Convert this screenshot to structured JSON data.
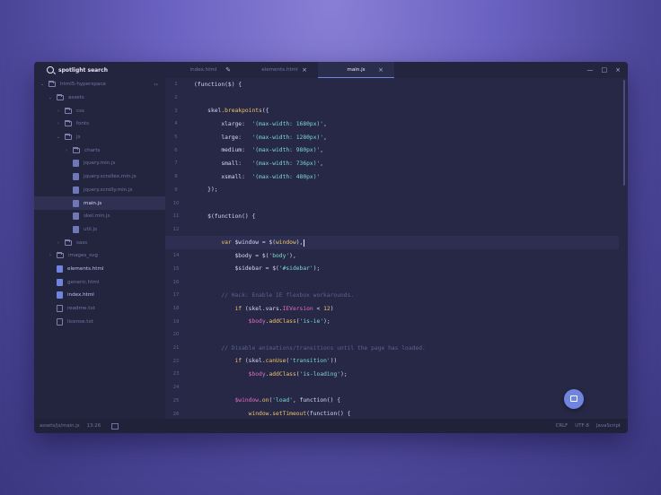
{
  "sidebar": {
    "search_label": "spotlight search",
    "tree": [
      {
        "label": "html5-hyperspace",
        "depth": 0,
        "kind": "folder",
        "chev": "⌄",
        "collapse": true
      },
      {
        "label": "assets",
        "depth": 1,
        "kind": "folder",
        "chev": "⌄"
      },
      {
        "label": "css",
        "depth": 2,
        "kind": "folder",
        "chev": "›"
      },
      {
        "label": "fonts",
        "depth": 2,
        "kind": "folder",
        "chev": "›"
      },
      {
        "label": "js",
        "depth": 2,
        "kind": "folder",
        "chev": "⌄"
      },
      {
        "label": "charts",
        "depth": 3,
        "kind": "folder",
        "chev": "›"
      },
      {
        "label": "jquery.min.js",
        "depth": 3,
        "kind": "js"
      },
      {
        "label": "jquery.scrollex.min.js",
        "depth": 3,
        "kind": "js"
      },
      {
        "label": "jquery.scrolly.min.js",
        "depth": 3,
        "kind": "js"
      },
      {
        "label": "main.js",
        "depth": 3,
        "kind": "js",
        "active": true
      },
      {
        "label": "skel.min.js",
        "depth": 3,
        "kind": "js"
      },
      {
        "label": "util.js",
        "depth": 3,
        "kind": "js"
      },
      {
        "label": "sass",
        "depth": 2,
        "kind": "folder",
        "chev": "›"
      },
      {
        "label": "images_svg",
        "depth": 1,
        "kind": "folder",
        "chev": "›"
      },
      {
        "label": "elements.html",
        "depth": 1,
        "kind": "html",
        "bright": true
      },
      {
        "label": "generic.html",
        "depth": 1,
        "kind": "html"
      },
      {
        "label": "index.html",
        "depth": 1,
        "kind": "html",
        "bright": true
      },
      {
        "label": "readme.txt",
        "depth": 1,
        "kind": "txt"
      },
      {
        "label": "license.txt",
        "depth": 1,
        "kind": "txt"
      }
    ],
    "collapse_label": "‹‹"
  },
  "tabs": [
    {
      "label": "index.html",
      "suffix": "✎",
      "active": false
    },
    {
      "label": "elements.html",
      "suffix": "×",
      "active": false
    },
    {
      "label": "main.js",
      "suffix": "×",
      "active": true
    }
  ],
  "window_controls": [
    "—",
    "□",
    "×"
  ],
  "code": [
    {
      "n": "1",
      "t": [
        [
          "(function($) {",
          "#d7d9f2"
        ]
      ]
    },
    {
      "n": "2",
      "t": []
    },
    {
      "n": "3",
      "t": [
        [
          "    skel.",
          "#d7d9f2"
        ],
        [
          "breakpoints",
          "#f0c36a"
        ],
        [
          "({",
          "#d7d9f2"
        ]
      ]
    },
    {
      "n": "4",
      "t": [
        [
          "        xlarge:  ",
          "#d7d9f2"
        ],
        [
          "'(max-width: 1680px)'",
          "#7fd8d0"
        ],
        [
          ",",
          "#d7d9f2"
        ]
      ]
    },
    {
      "n": "5",
      "t": [
        [
          "        large:   ",
          "#d7d9f2"
        ],
        [
          "'(max-width: 1280px)'",
          "#7fd8d0"
        ],
        [
          ",",
          "#d7d9f2"
        ]
      ]
    },
    {
      "n": "6",
      "t": [
        [
          "        medium:  ",
          "#d7d9f2"
        ],
        [
          "'(max-width: 980px)'",
          "#7fd8d0"
        ],
        [
          ",",
          "#d7d9f2"
        ]
      ]
    },
    {
      "n": "7",
      "t": [
        [
          "        small:   ",
          "#d7d9f2"
        ],
        [
          "'(max-width: 736px)'",
          "#7fd8d0"
        ],
        [
          ",",
          "#d7d9f2"
        ]
      ]
    },
    {
      "n": "8",
      "t": [
        [
          "        xsmall:  ",
          "#d7d9f2"
        ],
        [
          "'(max-width: 480px)'",
          "#7fd8d0"
        ]
      ]
    },
    {
      "n": "9",
      "t": [
        [
          "    });",
          "#d7d9f2"
        ]
      ]
    },
    {
      "n": "10",
      "t": []
    },
    {
      "n": "11",
      "t": [
        [
          "    $(function() {",
          "#d7d9f2"
        ]
      ]
    },
    {
      "n": "12",
      "t": []
    },
    {
      "n": "13",
      "t": [
        [
          "        ",
          "#d7d9f2"
        ],
        [
          "var",
          "#f0c36a"
        ],
        [
          " $window = $(",
          "#d7d9f2"
        ],
        [
          "window",
          "#f0c36a"
        ],
        [
          "),",
          "#d7d9f2"
        ]
      ],
      "cur": true
    },
    {
      "n": "14",
      "t": [
        [
          "            $body = $(",
          "#d7d9f2"
        ],
        [
          "'body'",
          "#7fd8d0"
        ],
        [
          "),",
          "#d7d9f2"
        ]
      ]
    },
    {
      "n": "15",
      "t": [
        [
          "            $sidebar = $(",
          "#d7d9f2"
        ],
        [
          "'#sidebar'",
          "#7fd8d0"
        ],
        [
          ");",
          "#d7d9f2"
        ]
      ]
    },
    {
      "n": "16",
      "t": []
    },
    {
      "n": "17",
      "t": [
        [
          "        // Hack: Enable IE flexbox workarounds.",
          "#5d6290"
        ]
      ]
    },
    {
      "n": "18",
      "t": [
        [
          "            ",
          "#d7d9f2"
        ],
        [
          "if",
          "#f0c36a"
        ],
        [
          " (skel.vars.",
          "#d7d9f2"
        ],
        [
          "IEVersion",
          "#e46ec0"
        ],
        [
          " < ",
          "#d7d9f2"
        ],
        [
          "12",
          "#f0c36a"
        ],
        [
          ")",
          "#d7d9f2"
        ]
      ]
    },
    {
      "n": "19",
      "t": [
        [
          "                ",
          "#d7d9f2"
        ],
        [
          "$body",
          "#e46ec0"
        ],
        [
          ".",
          "#d7d9f2"
        ],
        [
          "addClass",
          "#f0c36a"
        ],
        [
          "(",
          "#d7d9f2"
        ],
        [
          "'is-ie'",
          "#7fd8d0"
        ],
        [
          ");",
          "#d7d9f2"
        ]
      ]
    },
    {
      "n": "20",
      "t": []
    },
    {
      "n": "21",
      "t": [
        [
          "        // Disable animations/transitions until the page has loaded.",
          "#5d6290"
        ]
      ]
    },
    {
      "n": "22",
      "t": [
        [
          "            ",
          "#d7d9f2"
        ],
        [
          "if",
          "#f0c36a"
        ],
        [
          " (skel.",
          "#d7d9f2"
        ],
        [
          "canUse",
          "#f0c36a"
        ],
        [
          "(",
          "#d7d9f2"
        ],
        [
          "'transition'",
          "#7fd8d0"
        ],
        [
          "))",
          "#d7d9f2"
        ]
      ]
    },
    {
      "n": "23",
      "t": [
        [
          "                ",
          "#d7d9f2"
        ],
        [
          "$body",
          "#e46ec0"
        ],
        [
          ".",
          "#d7d9f2"
        ],
        [
          "addClass",
          "#f0c36a"
        ],
        [
          "(",
          "#d7d9f2"
        ],
        [
          "'is-loading'",
          "#7fd8d0"
        ],
        [
          ");",
          "#d7d9f2"
        ]
      ]
    },
    {
      "n": "24",
      "t": []
    },
    {
      "n": "25",
      "t": [
        [
          "            ",
          "#d7d9f2"
        ],
        [
          "$window",
          "#e46ec0"
        ],
        [
          ".",
          "#d7d9f2"
        ],
        [
          "on",
          "#f0c36a"
        ],
        [
          "(",
          "#d7d9f2"
        ],
        [
          "'load'",
          "#7fd8d0"
        ],
        [
          ", function() {",
          "#d7d9f2"
        ]
      ]
    },
    {
      "n": "26",
      "t": [
        [
          "                ",
          "#d7d9f2"
        ],
        [
          "window",
          "#f0c36a"
        ],
        [
          ".",
          "#d7d9f2"
        ],
        [
          "setTimeout",
          "#f0c36a"
        ],
        [
          "(function() {",
          "#d7d9f2"
        ]
      ]
    }
  ],
  "status": {
    "path": "assets/js/main.js",
    "cursor": "13:26",
    "line_ending": "CRLF",
    "encoding": "UTF-8",
    "language": "JavaScript"
  },
  "colors": {
    "accent": "#6f85e0",
    "bg": "#262846"
  }
}
